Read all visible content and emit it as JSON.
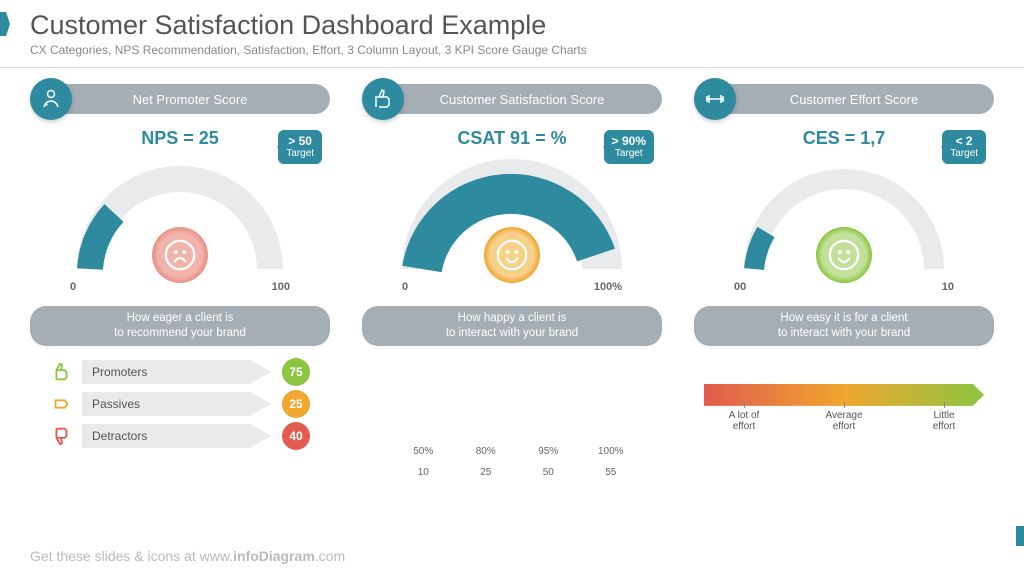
{
  "header": {
    "title": "Customer Satisfaction Dashboard Example",
    "subtitle": "CX Categories, NPS Recommendation, Satisfaction, Effort, 3 Column Layout, 3 KPI Score Gauge Charts"
  },
  "kpis": [
    {
      "name": "Net Promoter Score",
      "score_label": "NPS = 25",
      "target_value": "> 50",
      "target_text": "Target",
      "axis_min": "0",
      "axis_max": "100",
      "fill_pct": 25,
      "face": "sad",
      "face_color": "#e15b4e",
      "desc": "How eager a client is\nto recommend your brand"
    },
    {
      "name": "Customer Satisfaction Score",
      "score_label": "CSAT 91 = %",
      "target_value": "> 90%",
      "target_text": "Target",
      "axis_min": "0",
      "axis_max": "100%",
      "fill_pct": 91,
      "face": "happy",
      "face_color": "#f0a62f",
      "desc": "How happy a client is\nto interact with your brand"
    },
    {
      "name": "Customer Effort Score",
      "score_label": "CES = 1,7",
      "target_value": "< 2",
      "target_text": "Target",
      "axis_min": "00",
      "axis_max": "10",
      "fill_pct": 17,
      "face": "happy",
      "face_color": "#8cc540",
      "desc": "How easy it is for a client\nto interact with your brand"
    }
  ],
  "legend": [
    {
      "label": "Promoters",
      "value": "75",
      "color": "#8cc540"
    },
    {
      "label": "Passives",
      "value": "25",
      "color": "#f0a62f"
    },
    {
      "label": "Detractors",
      "value": "40",
      "color": "#e15b4e"
    }
  ],
  "effort_scale": [
    "A lot of\neffort",
    "Average\neffort",
    "Little\neffort"
  ],
  "footer_prefix": "Get these slides & icons at www.",
  "footer_brand": "infoDiagram",
  "footer_suffix": ".com",
  "chart_data": [
    {
      "type": "gauge",
      "title": "Net Promoter Score",
      "value": 25,
      "min": 0,
      "max": 100,
      "target": ">50"
    },
    {
      "type": "gauge",
      "title": "Customer Satisfaction Score",
      "value": 91,
      "min": 0,
      "max": 100,
      "target": ">90%",
      "unit": "%"
    },
    {
      "type": "gauge",
      "title": "Customer Effort Score",
      "value": 1.7,
      "min": 0,
      "max": 10,
      "target": "<2"
    },
    {
      "type": "bar",
      "title": "CSAT breakdown",
      "categories": [
        "10",
        "25",
        "50",
        "55"
      ],
      "values": [
        50,
        80,
        95,
        100
      ],
      "value_labels": [
        "50%",
        "80%",
        "95%",
        "100%"
      ],
      "ylim": [
        0,
        100
      ]
    }
  ]
}
